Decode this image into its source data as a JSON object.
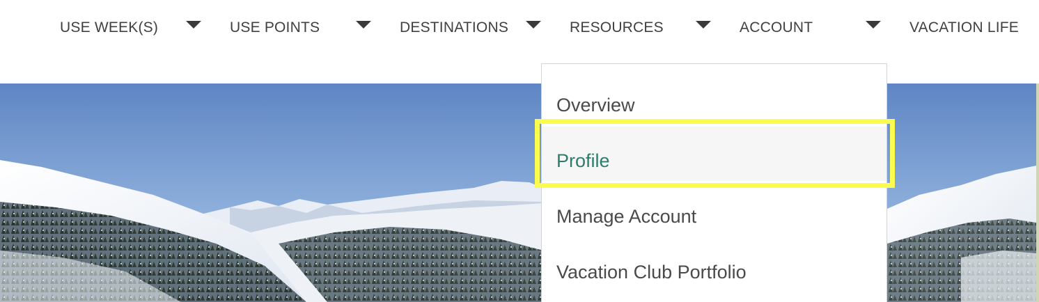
{
  "nav": {
    "items": [
      {
        "label": "USE WEEK(S)"
      },
      {
        "label": "USE POINTS"
      },
      {
        "label": "DESTINATIONS"
      },
      {
        "label": "RESOURCES"
      },
      {
        "label": "ACCOUNT"
      },
      {
        "label": "VACATION LIFE"
      }
    ]
  },
  "dropdown": {
    "items": [
      {
        "label": "Overview"
      },
      {
        "label": "Profile"
      },
      {
        "label": "Manage Account"
      },
      {
        "label": "Vacation Club Portfolio"
      }
    ],
    "highlighted_item": "Profile"
  },
  "colors": {
    "nav_text": "#404040",
    "active_item_text": "#2e7d6b",
    "highlight_outline": "#fbfb50"
  },
  "hero": {
    "scene": "snowy-mountain-landscape"
  }
}
